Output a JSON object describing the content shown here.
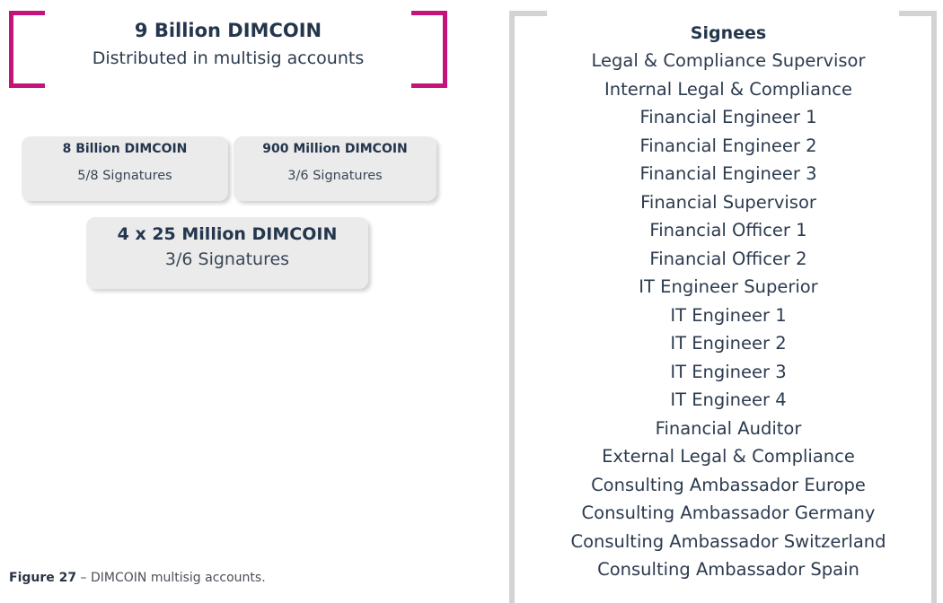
{
  "summary": {
    "title": "9 Billion DIMCOIN",
    "subtitle": "Distributed in multisig accounts"
  },
  "accounts": [
    {
      "amount": "8 Billion DIMCOIN",
      "signatures": "5/8 Signatures"
    },
    {
      "amount": "900 Million DIMCOIN",
      "signatures": "3/6 Signatures"
    },
    {
      "amount": "4 x 25 Million DIMCOIN",
      "signatures": "3/6 Signatures"
    }
  ],
  "signees": {
    "heading": "Signees",
    "items": [
      "Legal & Compliance Supervisor",
      "Internal Legal & Compliance",
      "Financial Engineer 1",
      "Financial Engineer 2",
      "Financial Engineer 3",
      "Financial Supervisor",
      "Financial Officer 1",
      "Financial Officer 2",
      "IT Engineer Superior",
      "IT Engineer 1",
      "IT Engineer 2",
      "IT Engineer 3",
      "IT Engineer 4",
      "Financial Auditor",
      "External Legal & Compliance",
      "Consulting Ambassador Europe",
      "Consulting Ambassador Germany",
      "Consulting Ambassador Switzerland",
      "Consulting Ambassador Spain"
    ]
  },
  "caption": {
    "label": "Figure 27",
    "text": " – DIMCOIN multisig accounts."
  },
  "colors": {
    "bracket": "#c4147a",
    "frame": "#d3d3d3",
    "box": "#ebebeb",
    "text": "#24364c"
  }
}
